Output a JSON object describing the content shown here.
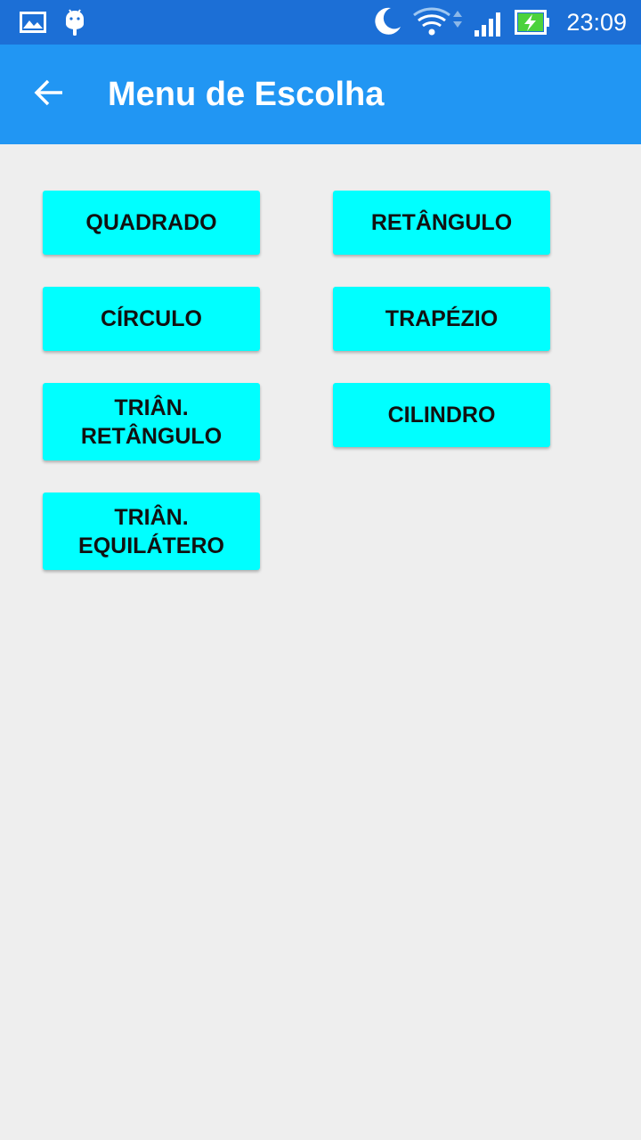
{
  "status_bar": {
    "time": "23:09",
    "icons": [
      "gallery-icon",
      "android-icon",
      "moon-icon",
      "wifi-icon",
      "signal-icon",
      "battery-charging-icon"
    ]
  },
  "app_bar": {
    "title": "Menu de Escolha",
    "back_icon": "arrow-back-icon"
  },
  "colors": {
    "status_bar": "#1c6fd6",
    "app_bar": "#2196f3",
    "button": "#00ffff",
    "background": "#eeeeee"
  },
  "buttons": {
    "quadrado": {
      "lines": [
        "QUADRADO"
      ]
    },
    "retangulo": {
      "lines": [
        "RETÂNGULO"
      ]
    },
    "circulo": {
      "lines": [
        "CÍRCULO"
      ]
    },
    "trapezio": {
      "lines": [
        "TRAPÉZIO"
      ]
    },
    "triangulo_retangulo": {
      "lines": [
        "TRIÂN.",
        "RETÂNGULO"
      ]
    },
    "cilindro": {
      "lines": [
        "CILINDRO"
      ]
    },
    "triangulo_equilatero": {
      "lines": [
        "TRIÂN.",
        "EQUILÁTERO"
      ]
    }
  }
}
